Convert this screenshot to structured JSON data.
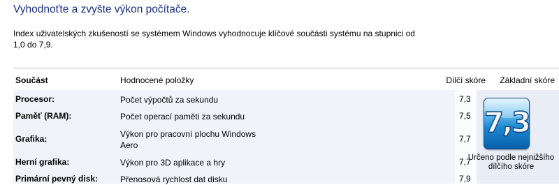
{
  "page": {
    "title": "Vyhodnoťte a zvyšte výkon počítače.",
    "description": "Index uživatelských zkušeností se systémem Windows vyhodnocuje klíčové součásti systému na stupnici od 1,0 do 7,9."
  },
  "table": {
    "headers": {
      "component": "Součást",
      "rated_items": "Hodnocené položky",
      "subscore": "Dílčí skóre",
      "base_score": "Základní skóre"
    },
    "rows": [
      {
        "component": "Procesor:",
        "item": "Počet výpočtů za sekundu",
        "score": "7,3"
      },
      {
        "component": "Paměť (RAM):",
        "item": "Počet operací paměti za sekundu",
        "score": "7,5"
      },
      {
        "component": "Grafika:",
        "item": "Výkon pro pracovní plochu Windows Aero",
        "score": "7,7"
      },
      {
        "component": "Herní grafika:",
        "item": "Výkon pro 3D aplikace a hry",
        "score": "7,7"
      },
      {
        "component": "Primární pevný disk:",
        "item": "Přenosová rychlost dat disku",
        "score": "7,9"
      }
    ]
  },
  "base_score": {
    "value": "7,3",
    "caption": "Určeno podle nejnižšího dílčího skóre"
  },
  "colors": {
    "title": "#1e3287",
    "row_background": "#f0f3f9",
    "base_column_background": "#e9edf6",
    "badge_blue": "#1a88d2"
  }
}
